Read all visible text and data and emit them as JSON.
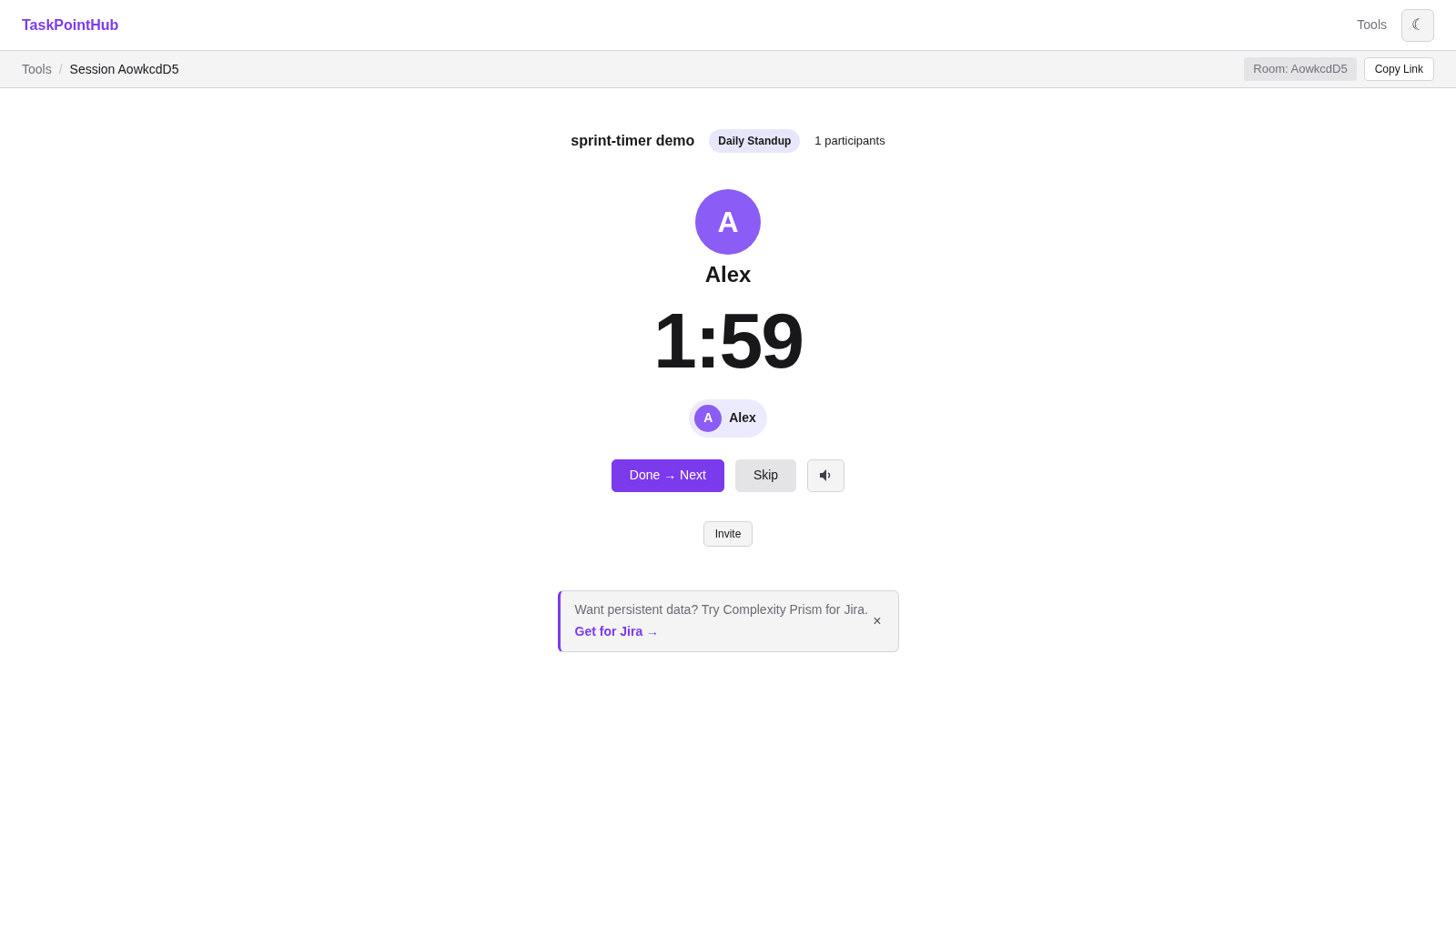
{
  "navbar": {
    "brand": "TaskPointHub",
    "links": [
      "Tools"
    ],
    "theme_toggle": "☾"
  },
  "breadcrumb": {
    "items": [
      {
        "label": "Tools",
        "current": false
      },
      {
        "label": "Session AowkcdD5",
        "current": true
      }
    ],
    "separator": "/",
    "room": "Room: AowkcdD5",
    "copy_button": "Copy Link"
  },
  "session": {
    "title": "sprint-timer demo",
    "badge": "Daily Standup",
    "participants": "1 participants"
  },
  "speaker": {
    "initial": "A",
    "name": "Alex"
  },
  "timer": "1:59",
  "participants": [
    {
      "initial": "A",
      "name": "Alex"
    }
  ],
  "controls": [
    {
      "kind": "primary",
      "label": "Done → Next"
    },
    {
      "kind": "secondary",
      "label": "Skip"
    },
    {
      "kind": "icon"
    }
  ],
  "invite": "Invite",
  "promo": {
    "text": "Want persistent data? Try Complexity Prism for Jira.",
    "link": "Get for Jira →",
    "close": "×"
  }
}
